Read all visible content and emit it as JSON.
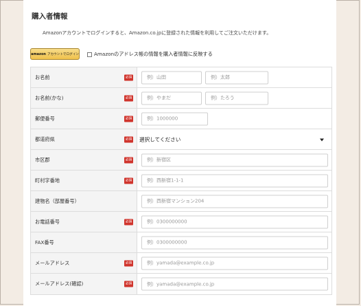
{
  "section": {
    "title": "購入者情報",
    "description": "Amazonアカウントでログインすると、Amazon.co.jpに登録された情報を利用してご注文いただけます。",
    "amazon_button": {
      "logo": "amazon",
      "label": "アカウントでログイン"
    },
    "reflect_label": "Amazonのアドレス帳の情報を購入者情報に反映する"
  },
  "form": {
    "required_badge": "必須",
    "fields": [
      {
        "label": "お名前",
        "required": true,
        "placeholders": [
          "例）山田",
          "例）太郎"
        ]
      },
      {
        "label": "お名前(かな)",
        "required": true,
        "placeholders": [
          "例）やまだ",
          "例）たろう"
        ]
      },
      {
        "label": "郵便番号",
        "required": true,
        "placeholders": [
          "例）1000000"
        ]
      },
      {
        "label": "都道府県",
        "required": true,
        "select_value": "選択してください"
      },
      {
        "label": "市区郡",
        "required": true,
        "placeholders": [
          "例）新宿区"
        ]
      },
      {
        "label": "町村字番地",
        "required": true,
        "placeholders": [
          "例）西新宿1-1-1"
        ]
      },
      {
        "label": "建物名（部屋番号）",
        "required": false,
        "placeholders": [
          "例）西新宿マンション204"
        ]
      },
      {
        "label": "お電話番号",
        "required": true,
        "placeholders": [
          "例）0300000000"
        ]
      },
      {
        "label": "FAX番号",
        "required": false,
        "placeholders": [
          "例）0300000000"
        ]
      },
      {
        "label": "メールアドレス",
        "required": true,
        "placeholders": [
          "例）yamada@example.co.jp"
        ]
      },
      {
        "label": "メールアドレス(確認)",
        "required": true,
        "placeholders": [
          "例）yamada@example.co.jp"
        ]
      }
    ]
  }
}
